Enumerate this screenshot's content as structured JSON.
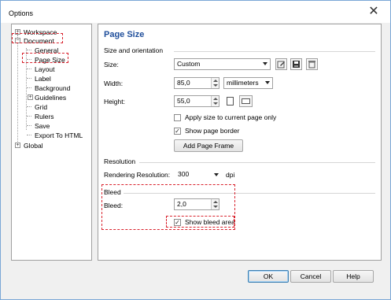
{
  "window": {
    "title": "Options",
    "close_glyph": "✕"
  },
  "tree": {
    "items": [
      {
        "label": "Workspace",
        "expander": "+"
      },
      {
        "label": "Document",
        "expander": "−"
      },
      {
        "label": "General"
      },
      {
        "label": "Page Size"
      },
      {
        "label": "Layout"
      },
      {
        "label": "Label"
      },
      {
        "label": "Background"
      },
      {
        "label": "Guidelines",
        "expander": "+"
      },
      {
        "label": "Grid"
      },
      {
        "label": "Rulers"
      },
      {
        "label": "Save"
      },
      {
        "label": "Export To HTML"
      },
      {
        "label": "Global",
        "expander": "+"
      }
    ]
  },
  "panel": {
    "title": "Page Size",
    "size_orientation": {
      "header": "Size and orientation",
      "size_label": "Size:",
      "size_value": "Custom",
      "width_label": "Width:",
      "width_value": "85,0",
      "units_value": "millimeters",
      "height_label": "Height:",
      "height_value": "55,0",
      "apply_label": "Apply size to current page only",
      "apply_checked": false,
      "border_label": "Show page border",
      "border_checked": true,
      "add_frame_label": "Add Page Frame"
    },
    "resolution": {
      "header": "Resolution",
      "rendering_label": "Rendering Resolution:",
      "rendering_value": "300",
      "dpi_label": "dpi"
    },
    "bleed": {
      "header": "Bleed",
      "bleed_label": "Bleed:",
      "bleed_value": "2,0",
      "show_bleed_label": "Show bleed area",
      "show_bleed_checked": true
    }
  },
  "footer": {
    "ok_label": "OK",
    "cancel_label": "Cancel",
    "help_label": "Help"
  },
  "colors": {
    "highlight_dash": "#d9232e",
    "title_blue": "#1f4e9b",
    "window_border": "#7aa7d6"
  },
  "icons": [
    "close-icon",
    "expand-icon",
    "collapse-icon",
    "save-preset-icon",
    "floppy-save-icon",
    "delete-preset-icon",
    "portrait-icon",
    "landscape-icon",
    "checkmark-icon"
  ]
}
